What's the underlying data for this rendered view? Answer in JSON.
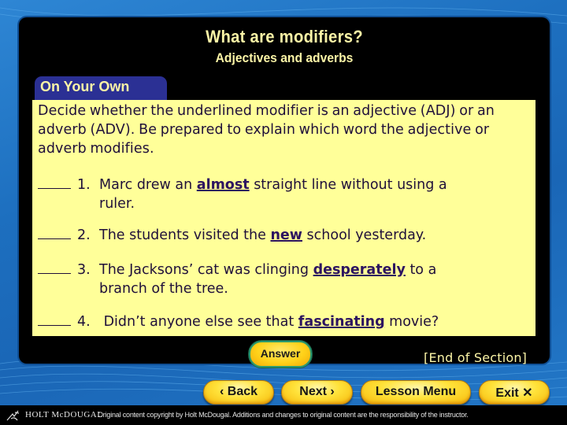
{
  "header": {
    "title": "What are modifiers?",
    "subtitle": "Adjectives and adverbs"
  },
  "tab": {
    "label": "On Your Own"
  },
  "content": {
    "instructions": "Decide whether the underlined modifier is an adjective (ADJ) or an adverb (ADV). Be prepared to explain which word the adjective or adverb modifies.",
    "items": [
      {
        "number": "1.",
        "before": "Marc drew an ",
        "modifier": "almost",
        "after": " straight line without using a",
        "line2": "ruler."
      },
      {
        "number": "2.",
        "before": "The students visited the ",
        "modifier": "new",
        "after": " school yesterday.",
        "line2": ""
      },
      {
        "number": "3.",
        "before": "The Jacksons’ cat was clinging ",
        "modifier": "desperately",
        "after": " to a",
        "line2": "branch of the tree."
      },
      {
        "number": "4.",
        "before": " Didn’t anyone else see that ",
        "modifier": "fascinating",
        "after": " movie?",
        "line2": ""
      }
    ]
  },
  "buttons": {
    "answer": "Answer",
    "back": "‹ Back",
    "next": "Next ›",
    "lesson_menu": "Lesson Menu",
    "exit": "Exit ✕"
  },
  "end_of_section": "[End of Section]",
  "footer": {
    "brand": "HOLT McDOUGAL",
    "copyright": "Original content copyright by Holt McDougal.  Additions and changes to original content are the responsibility of the instructor."
  },
  "colors": {
    "title_yellow": "#fbf4a6",
    "content_bg": "#ffff99",
    "tab_blue": "#2b3094",
    "button_yellow": "#ffd21a",
    "answer_border": "#2a9a6f"
  }
}
